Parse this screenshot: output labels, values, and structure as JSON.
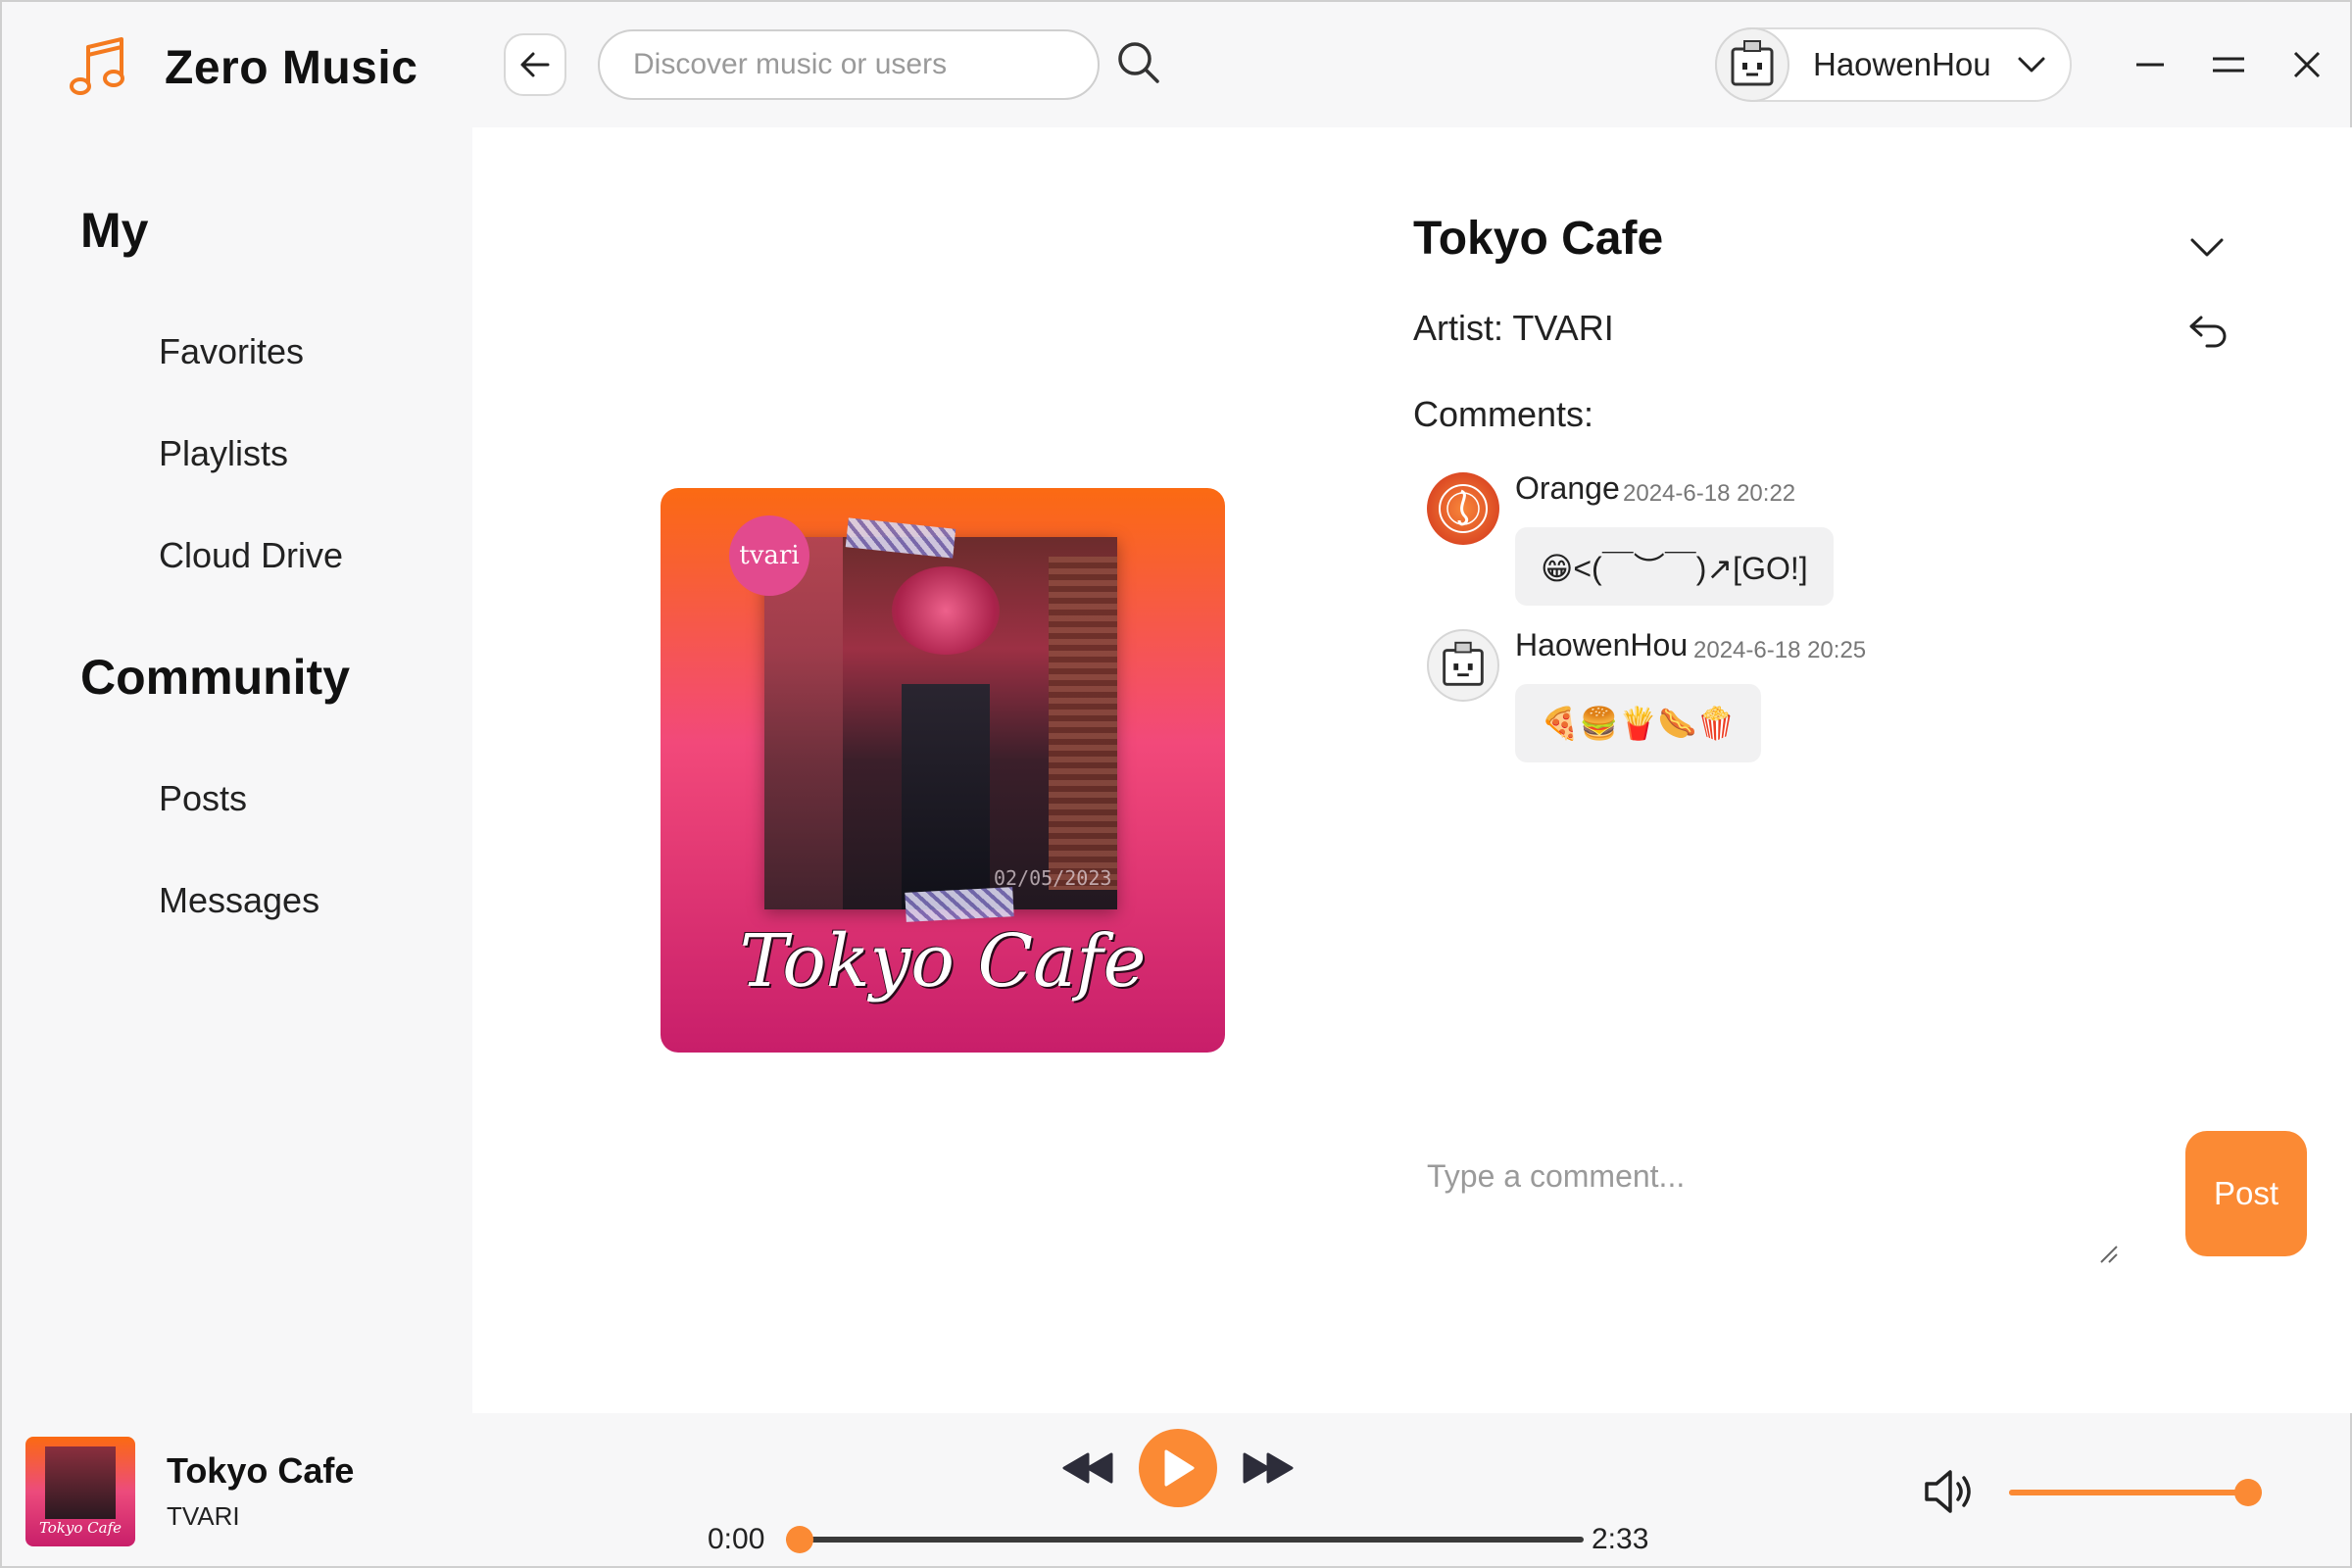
{
  "app": {
    "title": "Zero Music"
  },
  "search": {
    "placeholder": "Discover music or users"
  },
  "user": {
    "name": "HaowenHou"
  },
  "sidebar": {
    "sections": [
      {
        "heading": "My",
        "items": [
          "Favorites",
          "Playlists",
          "Cloud Drive"
        ]
      },
      {
        "heading": "Community",
        "items": [
          "Posts",
          "Messages"
        ]
      }
    ]
  },
  "song": {
    "title": "Tokyo Cafe",
    "artist_line": "Artist: TVARI",
    "cover_badge": "tvari",
    "cover_script": "Tokyo Cafe",
    "cover_date": "02/05/2023"
  },
  "comments": {
    "label": "Comments:",
    "items": [
      {
        "user": "Orange",
        "time": "2024-6-18 20:22",
        "text": "😁<(￣︶￣)↗[GO!]"
      },
      {
        "user": "HaowenHou",
        "time": "2024-6-18 20:25",
        "text": "🍕🍔🍟🌭🍿"
      }
    ],
    "input_placeholder": "Type a comment...",
    "post_label": "Post"
  },
  "player": {
    "title": "Tokyo Cafe",
    "artist": "TVARI",
    "current_time": "0:00",
    "total_time": "2:33",
    "progress": 0.0,
    "volume": 1.0
  },
  "colors": {
    "accent": "#fb8a34"
  }
}
